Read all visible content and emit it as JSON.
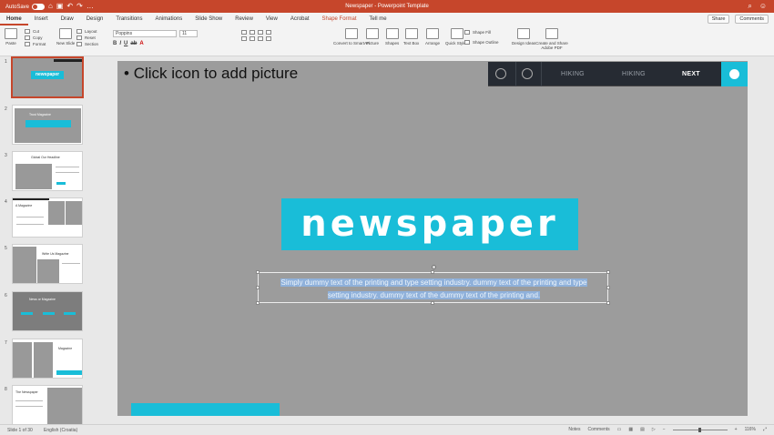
{
  "titlebar": {
    "autosave_label": "AutoSave",
    "autosave_state": "off",
    "doc_title": "Newspaper - Powerpoint Template"
  },
  "tabs": [
    "Home",
    "Insert",
    "Draw",
    "Design",
    "Transitions",
    "Animations",
    "Slide Show",
    "Review",
    "View",
    "Acrobat",
    "Shape Format",
    "Tell me"
  ],
  "share_label": "Share",
  "comments_label": "Comments",
  "ribbon": {
    "paste": "Paste",
    "cut": "Cut",
    "copy": "Copy",
    "format": "Format",
    "new_slide": "New Slide",
    "layout": "Layout",
    "reset": "Reset",
    "section": "Section",
    "font_name": "Poppins",
    "font_size": "11",
    "convert_smartart": "Convert to SmartArt",
    "picture": "Picture",
    "shapes": "Shapes",
    "text_box": "Text Box",
    "arrange": "Arrange",
    "quick_styles": "Quick Styles",
    "shape_fill": "Shape Fill",
    "shape_outline": "Shape Outline",
    "design_ideas": "Design Ideas",
    "create_share_pdf": "Create and Share Adobe PDF"
  },
  "slides": [
    "1",
    "2",
    "3",
    "4",
    "5",
    "6",
    "7",
    "8"
  ],
  "thumb_titles": {
    "t1": "newspaper",
    "t2": "Trust Magazine",
    "t3": "Global Our Headline",
    "t4": "A Magazine",
    "t5": "Write Us Magazine",
    "t6": "News or Magazine",
    "t7": "Magazine",
    "t8": "The Newspaper"
  },
  "slide": {
    "placeholder": "Click icon to add picture",
    "menu": {
      "item1": "HIKING",
      "item2": "HIKING",
      "item3": "NEXT"
    },
    "title": "newspaper",
    "body_line1": "Simply dummy text of the printing and type setting industry. dummy text of the printing and type",
    "body_line2": "setting industry. dummy text of the dummy text of the printing and."
  },
  "status": {
    "slide_info": "Slide 1 of 30",
    "language": "English (Croatia)",
    "notes": "Notes",
    "comments": "Comments",
    "zoom": "116%"
  },
  "colors": {
    "accent": "#c6462b",
    "cyan": "#19bdd8",
    "slide_bg": "#9c9c9c",
    "menu_bg": "#262b33"
  }
}
